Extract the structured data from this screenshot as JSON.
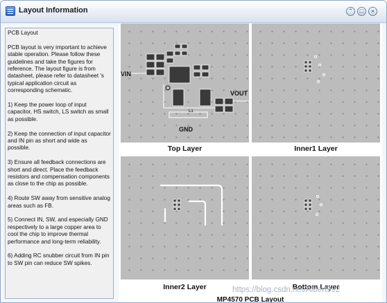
{
  "window": {
    "title": "Layout Information",
    "buttons": {
      "collapse": "⌃",
      "maximize": "□",
      "close": "×"
    }
  },
  "instructions": {
    "heading": "PCB Layout",
    "paragraphs": [
      "PCB layout is very important to achieve stable operation. Please follow these guidelines and take the figures for reference. The layout figure is from datasheet, please refer to datasheet  's typical application circuit as corresponding schematic.",
      "1)  Keep the power loop of input capacitor, HS switch, LS switch as small as possible.",
      "2)  Keep the connection of input capacitor and IN pin as short and wide as possible.",
      "3)  Ensure all feedback connections are short and direct. Place the feedback resistors and compensation components as close to the chip as possible.",
      "4)  Route SW away from sensitive analog areas such as FB.",
      "5)  Connect IN, SW, and especially GND respectively to a large copper area to cool the chip to improve thermal performance and long-term reliability.",
      "6)  Adding RC snubber circuit from IN pin to SW pin can reduce SW spikes."
    ]
  },
  "layout_figure": {
    "layers": {
      "top": "Top Layer",
      "inner1": "Inner1 Layer",
      "inner2": "Inner2 Layer",
      "bottom": "Bottom Layer"
    },
    "top_layer_labels": {
      "vin": "VIN",
      "vout": "VOUT",
      "gnd": "GND",
      "inductor": "L1"
    },
    "caption": "MP4570 PCB Layout"
  },
  "watermark": "https://blog.csdn.net/Albert992",
  "colors": {
    "board": "#bcbcbc",
    "pad": "#3a3a3a",
    "trace": "#ffffff",
    "title_gradient_end": "#d8e2ef"
  }
}
